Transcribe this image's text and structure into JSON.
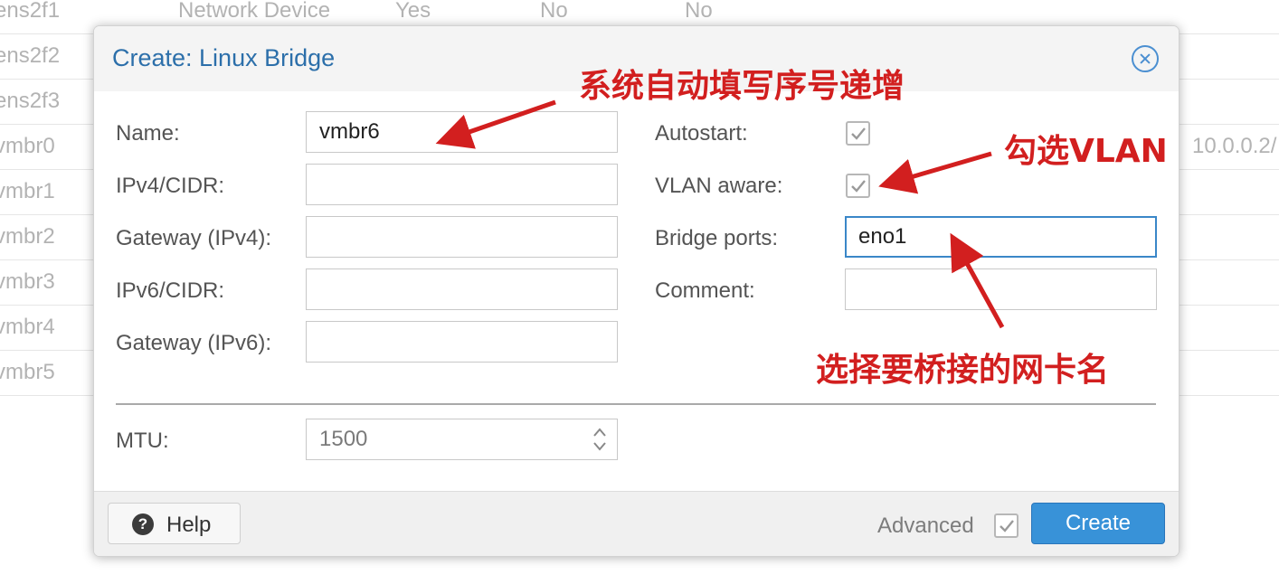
{
  "background_table": {
    "rows": [
      {
        "name": "ens2f1",
        "type": "Network Device",
        "active": "Yes",
        "autostart": "No",
        "vlan_aware": "No",
        "cidr": ""
      },
      {
        "name": "ens2f2",
        "type": "",
        "active": "",
        "autostart": "",
        "vlan_aware": "",
        "cidr": ""
      },
      {
        "name": "ens2f3",
        "type": "",
        "active": "",
        "autostart": "",
        "vlan_aware": "",
        "cidr": ""
      },
      {
        "name": "vmbr0",
        "type": "",
        "active": "",
        "autostart": "",
        "vlan_aware": "",
        "cidr": "10.0.0.2/"
      },
      {
        "name": "vmbr1",
        "type": "",
        "active": "",
        "autostart": "",
        "vlan_aware": "",
        "cidr": ""
      },
      {
        "name": "vmbr2",
        "type": "",
        "active": "",
        "autostart": "",
        "vlan_aware": "",
        "cidr": ""
      },
      {
        "name": "vmbr3",
        "type": "",
        "active": "",
        "autostart": "",
        "vlan_aware": "",
        "cidr": ""
      },
      {
        "name": "vmbr4",
        "type": "",
        "active": "",
        "autostart": "",
        "vlan_aware": "",
        "cidr": ""
      },
      {
        "name": "vmbr5",
        "type": "",
        "active": "",
        "autostart": "",
        "vlan_aware": "",
        "cidr": ""
      }
    ]
  },
  "dialog": {
    "title": "Create: Linux Bridge",
    "close_icon": "close-circle-icon",
    "left_fields": [
      {
        "label": "Name:",
        "value": "vmbr6"
      },
      {
        "label": "IPv4/CIDR:",
        "value": ""
      },
      {
        "label": "Gateway (IPv4):",
        "value": ""
      },
      {
        "label": "IPv6/CIDR:",
        "value": ""
      },
      {
        "label": "Gateway (IPv6):",
        "value": ""
      }
    ],
    "autostart": {
      "label": "Autostart:",
      "checked": true
    },
    "vlan_aware": {
      "label": "VLAN aware:",
      "checked": true
    },
    "bridge_ports": {
      "label": "Bridge ports:",
      "value": "eno1"
    },
    "comment": {
      "label": "Comment:",
      "value": ""
    },
    "mtu": {
      "label": "MTU:",
      "value": "1500"
    },
    "footer": {
      "help_label": "Help",
      "help_icon": "question-circle-icon",
      "advanced_label": "Advanced",
      "advanced_checked": true,
      "create_label": "Create"
    }
  },
  "annotations": {
    "name_note": "系统自动填写序号递增",
    "vlan_note": "勾选VLAN",
    "ports_note": "选择要桥接的网卡名"
  },
  "colors": {
    "accent_blue": "#3892d8",
    "title_blue": "#2c6faa",
    "annotation_red": "#d21f1f"
  }
}
